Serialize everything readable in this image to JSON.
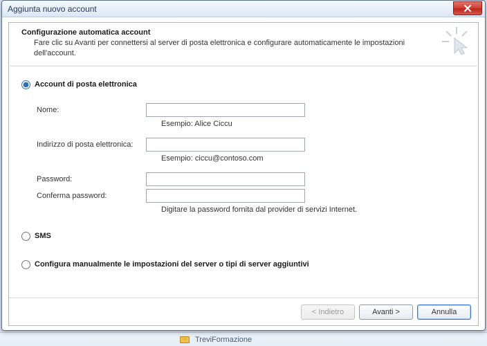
{
  "window": {
    "title": "Aggiunta nuovo account"
  },
  "header": {
    "title": "Configurazione automatica account",
    "desc": "Fare clic su Avanti per connettersi al server di posta elettronica e configurare automaticamente le impostazioni dell'account."
  },
  "options": {
    "email": "Account di posta elettronica",
    "sms": "SMS",
    "manual": "Configura manualmente le impostazioni del server o tipi di server aggiuntivi"
  },
  "form": {
    "name_label": "Nome:",
    "name_hint": "Esempio: Alice Ciccu",
    "email_label": "Indirizzo di posta elettronica:",
    "email_hint": "Esempio: ciccu@contoso.com",
    "password_label": "Password:",
    "confirm_label": "Conferma password:",
    "password_hint": "Digitare la password fornita dal provider di servizi Internet."
  },
  "buttons": {
    "back": "< Indietro",
    "next": "Avanti >",
    "cancel": "Annulla"
  },
  "bg": {
    "item": "TreviFormazione"
  }
}
